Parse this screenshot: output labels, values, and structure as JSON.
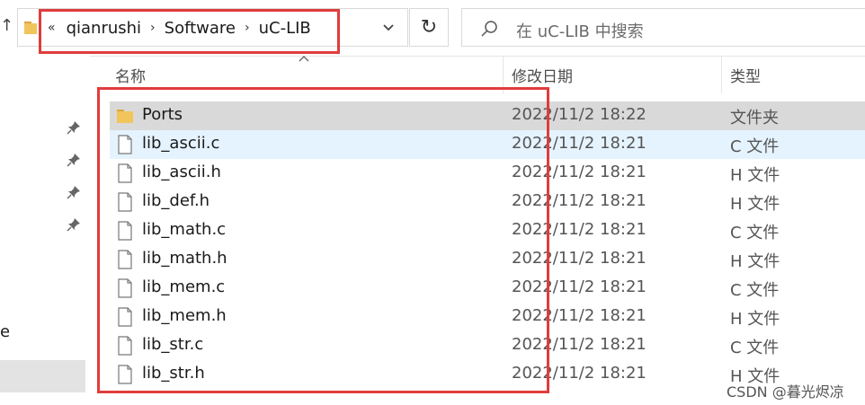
{
  "address_bar": {
    "overflow_label": "«",
    "crumbs": [
      "qianrushi",
      "Software",
      "uC-LIB"
    ],
    "separator": "›"
  },
  "refresh_label": "↻",
  "up_label": "↑",
  "search": {
    "placeholder": "在 uC-LIB 中搜索"
  },
  "columns": {
    "name": "名称",
    "date": "修改日期",
    "type": "类型"
  },
  "nav": {
    "truncated_text": "e"
  },
  "files": [
    {
      "name": "Ports",
      "date": "2022/11/2 18:22",
      "type": "文件夹",
      "icon": "folder-icon",
      "state": "selected"
    },
    {
      "name": "lib_ascii.c",
      "date": "2022/11/2 18:21",
      "type": "C 文件",
      "icon": "file-icon",
      "state": "hover"
    },
    {
      "name": "lib_ascii.h",
      "date": "2022/11/2 18:21",
      "type": "H 文件",
      "icon": "file-icon",
      "state": ""
    },
    {
      "name": "lib_def.h",
      "date": "2022/11/2 18:21",
      "type": "H 文件",
      "icon": "file-icon",
      "state": ""
    },
    {
      "name": "lib_math.c",
      "date": "2022/11/2 18:21",
      "type": "C 文件",
      "icon": "file-icon",
      "state": ""
    },
    {
      "name": "lib_math.h",
      "date": "2022/11/2 18:21",
      "type": "H 文件",
      "icon": "file-icon",
      "state": ""
    },
    {
      "name": "lib_mem.c",
      "date": "2022/11/2 18:21",
      "type": "C 文件",
      "icon": "file-icon",
      "state": ""
    },
    {
      "name": "lib_mem.h",
      "date": "2022/11/2 18:21",
      "type": "H 文件",
      "icon": "file-icon",
      "state": ""
    },
    {
      "name": "lib_str.c",
      "date": "2022/11/2 18:21",
      "type": "C 文件",
      "icon": "file-icon",
      "state": ""
    },
    {
      "name": "lib_str.h",
      "date": "2022/11/2 18:21",
      "type": "H 文件",
      "icon": "file-icon",
      "state": ""
    }
  ],
  "watermark": "CSDN @暮光烬凉",
  "colors": {
    "highlight_border": "#e03c3c",
    "selected_row": "#d9d9d9",
    "hover_row": "#e5f3ff",
    "folder": "#e8b84a"
  }
}
